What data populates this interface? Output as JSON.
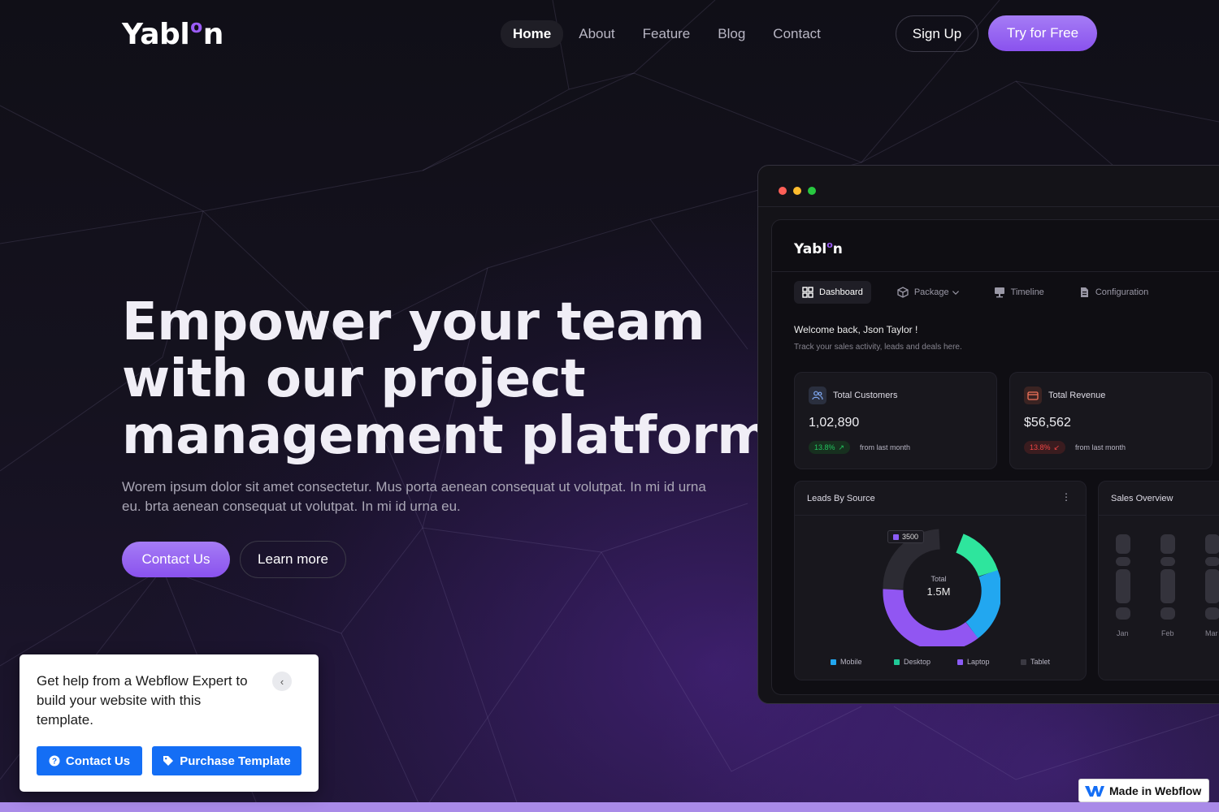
{
  "brand": {
    "logo_left": "Yabl",
    "logo_o": "o",
    "logo_right": "n"
  },
  "nav": {
    "items": [
      {
        "label": "Home",
        "active": true
      },
      {
        "label": "About",
        "active": false
      },
      {
        "label": "Feature",
        "active": false
      },
      {
        "label": "Blog",
        "active": false
      },
      {
        "label": "Contact",
        "active": false
      }
    ],
    "signup_label": "Sign Up",
    "try_label": "Try for Free"
  },
  "hero": {
    "title_lines": [
      "Empower your team",
      "with our project",
      "management platform"
    ],
    "subtitle": "Worem ipsum dolor sit amet consectetur. Mus porta aenean consequat ut volutpat. In mi id urna eu. brta aenean consequat ut volutpat. In mi id urna eu.",
    "contact_label": "Contact Us",
    "learn_label": "Learn more"
  },
  "dashboard": {
    "logo_left": "Yabl",
    "logo_o": "o",
    "logo_right": "n",
    "tabs": [
      {
        "label": "Dashboard",
        "icon": "grid-icon",
        "active": true
      },
      {
        "label": "Package",
        "icon": "box-icon",
        "active": false,
        "dropdown": true
      },
      {
        "label": "Timeline",
        "icon": "monitor-icon",
        "active": false
      },
      {
        "label": "Configuration",
        "icon": "file-icon",
        "active": false
      }
    ],
    "welcome": "Welcome back, Json Taylor !",
    "track": "Track your sales activity, leads and deals here.",
    "kpis": [
      {
        "label": "Total Customers",
        "value": "1,02,890",
        "change": "13.8%",
        "trend": "up",
        "from": "from last month",
        "icon": "users-icon",
        "color": "#22c55e"
      },
      {
        "label": "Total Revenue",
        "value": "$56,562",
        "change": "13.8%",
        "trend": "down",
        "from": "from last month",
        "icon": "card-icon",
        "color": "#ef4444"
      }
    ],
    "leads": {
      "title": "Leads By Source",
      "badge": "3500",
      "total_label": "Total",
      "total_value": "1.5M",
      "legend": [
        {
          "label": "Mobile",
          "color": "#22a7f0"
        },
        {
          "label": "Desktop",
          "color": "#20c997"
        },
        {
          "label": "Laptop",
          "color": "#8b5cf6"
        },
        {
          "label": "Tablet",
          "color": "#3a3942"
        }
      ]
    },
    "sales": {
      "title": "Sales Overview",
      "months": [
        "Jan",
        "Feb",
        "Mar"
      ]
    }
  },
  "webflow": {
    "help_text": "Get help from a Webflow Expert to build your website with this template.",
    "contact_label": "Contact Us",
    "purchase_label": "Purchase Template",
    "badge_label": "Made in Webflow"
  }
}
